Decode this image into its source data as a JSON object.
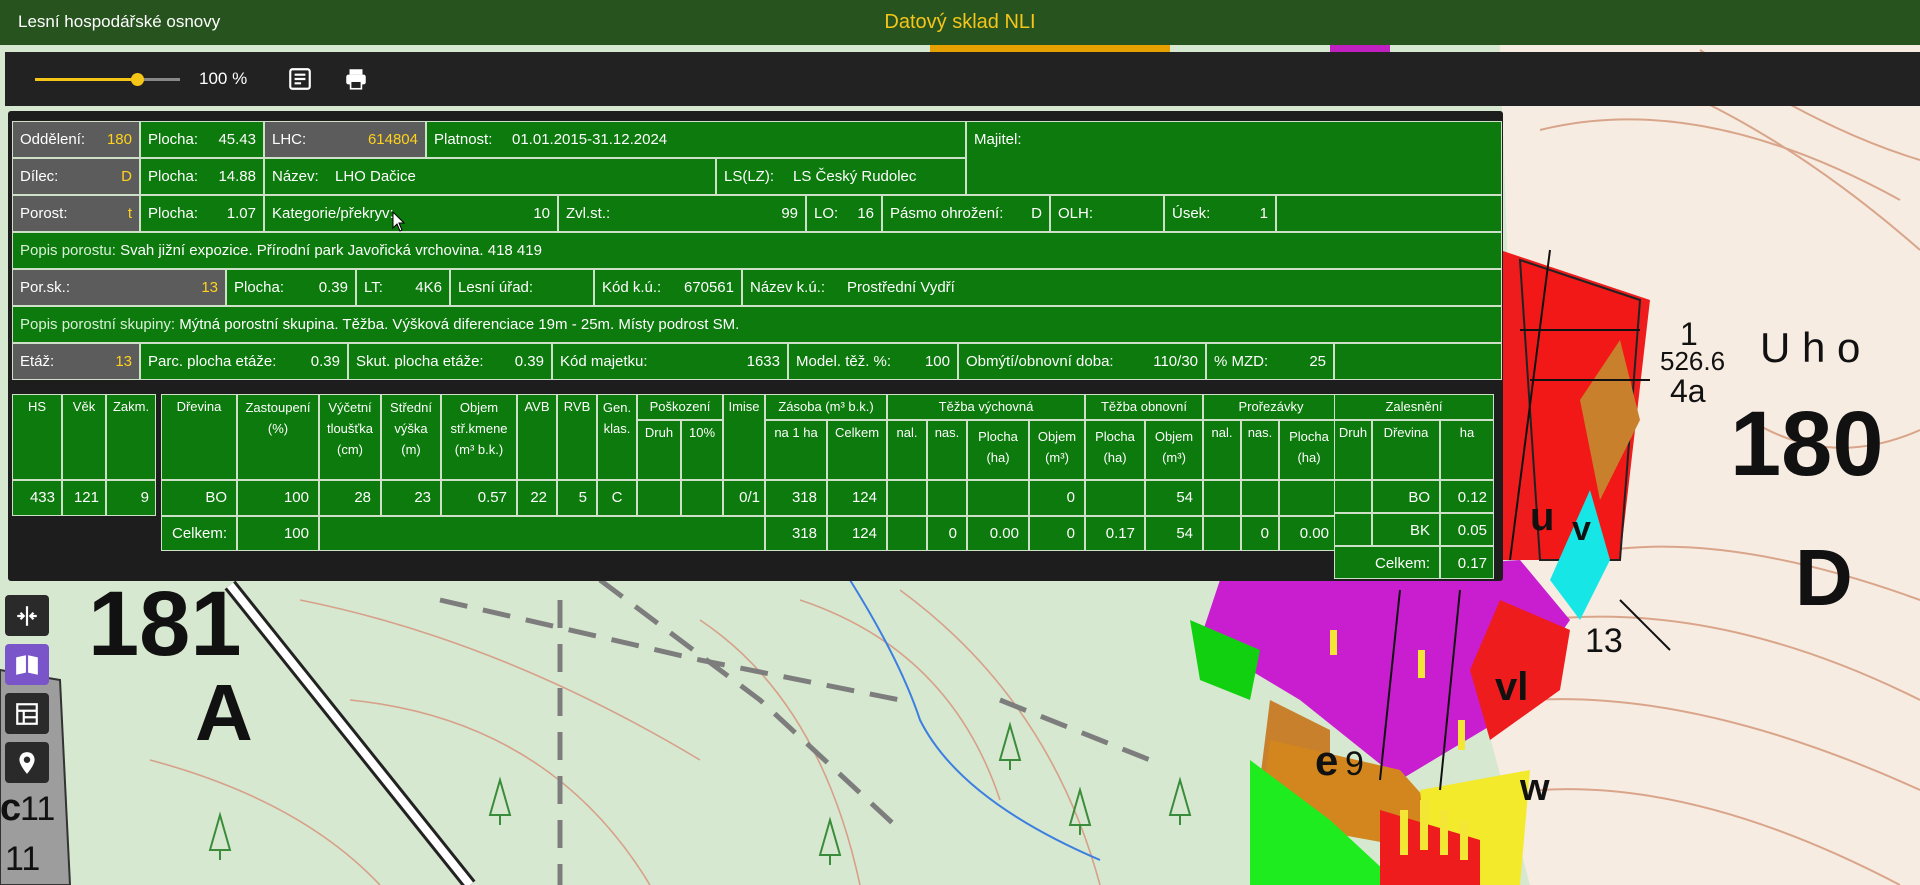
{
  "app": {
    "title": "Lesní hospodářské osnovy",
    "center_title": "Datový sklad NLI"
  },
  "toolbar": {
    "zoom_value": 0.7,
    "zoom_label": "100 %"
  },
  "header": {
    "oddeleni_label": "Oddělení:",
    "oddeleni_value": "180",
    "plocha1_label": "Plocha:",
    "plocha1_value": "45.43",
    "lhc_label": "LHC:",
    "lhc_value": "614804",
    "platnost_label": "Platnost:",
    "platnost_value": "01.01.2015-31.12.2024",
    "majitel_label": "Majitel:",
    "dilec_label": "Dílec:",
    "dilec_value": "D",
    "plocha2_label": "Plocha:",
    "plocha2_value": "14.88",
    "nazev_label": "Název:",
    "nazev_value": "LHO Dačice",
    "lslz_label": "LS(LZ):",
    "lslz_value": "LS Český Rudolec",
    "porost_label": "Porost:",
    "porost_value": "t",
    "plocha3_label": "Plocha:",
    "plocha3_value": "1.07",
    "kategorie_label": "Kategorie/překryv:",
    "kategorie_value": "10",
    "zvlst_label": "Zvl.st.:",
    "zvlst_value": "99",
    "lo_label": "LO:",
    "lo_value": "16",
    "pasmo_label": "Pásmo ohrožení:",
    "pasmo_value": "D",
    "olh_label": "OLH:",
    "usek_label": "Úsek:",
    "usek_value": "1",
    "popis_porostu_label": "Popis porostu:",
    "popis_porostu_value": "Svah jižní expozice. Přírodní park Javořická vrchovina. 418 419",
    "porsk_label": "Por.sk.:",
    "porsk_value": "13",
    "plocha4_label": "Plocha:",
    "plocha4_value": "0.39",
    "lt_label": "LT:",
    "lt_value": "4K6",
    "lesni_urad_label": "Lesní úřad:",
    "kodku_label": "Kód k.ú.:",
    "kodku_value": "670561",
    "nazevku_label": "Název k.ú.:",
    "nazevku_value": "Prostřední Vydří",
    "popis_skupiny_label": "Popis porostní skupiny:",
    "popis_skupiny_value": "Mýtná porostní skupina. Těžba. Výšková diferenciace 19m - 25m. Místy podrost SM.",
    "etaz_label": "Etáž:",
    "etaz_value": "13",
    "parc_label": "Parc. plocha etáže:",
    "parc_value": "0.39",
    "skut_label": "Skut. plocha etáže:",
    "skut_value": "0.39",
    "kodmaj_label": "Kód majetku:",
    "kodmaj_value": "1633",
    "model_label": "Model. těž. %:",
    "model_value": "100",
    "obmyti_label": "Obmýtí/obnovní doba:",
    "obmyti_value": "110/30",
    "mzd_label": "% MZD:",
    "mzd_value": "25"
  },
  "left_table": {
    "headers": [
      "HS",
      "Věk",
      "Zakm."
    ],
    "values": [
      "433",
      "121",
      "9"
    ]
  },
  "main_table": {
    "h_drevina": "Dřevina",
    "h_zastoupeni": [
      "Zastoupení",
      "(%)"
    ],
    "h_vycetni": [
      "Výčetní",
      "tloušťka",
      "(cm)"
    ],
    "h_stredni": [
      "Střední",
      "výška",
      "(m)"
    ],
    "h_objem": [
      "Objem",
      "stř.kmene",
      "(m³ b.k.)"
    ],
    "h_avb": "AVB",
    "h_rvb": "RVB",
    "h_gen": [
      "Gen.",
      "klas."
    ],
    "h_poskozeni": "Poškození",
    "h_druh": "Druh",
    "h_10": "10%",
    "h_imise": "Imise",
    "h_zasoba": "Zásoba (m³ b.k.)",
    "h_na1ha": "na 1 ha",
    "h_celkem": "Celkem",
    "h_tv": "Těžba výchovná",
    "h_nal": "nal.",
    "h_nas": "nas.",
    "h_plocha": [
      "Plocha",
      "(ha)"
    ],
    "h_objem2": [
      "Objem",
      "(m³)"
    ],
    "h_to": "Těžba obnovní",
    "h_prorezavky": "Prořezávky",
    "row": {
      "drevina": "BO",
      "zastoupeni": "100",
      "vycetni": "28",
      "stredni": "23",
      "objem": "0.57",
      "avb": "22",
      "rvb": "5",
      "gen": "C",
      "imise": "0/1",
      "na1ha": "318",
      "celkem": "124",
      "tv_objem": "0",
      "to_objem": "54"
    },
    "total": {
      "label": "Celkem:",
      "zastoupeni": "100",
      "na1ha": "318",
      "celkem": "124",
      "tv_nas": "0",
      "tv_plocha": "0.00",
      "tv_objem": "0",
      "to_plocha": "0.17",
      "to_objem": "54",
      "pr_nas": "0",
      "pr_plocha": "0.00"
    }
  },
  "zalesneni": {
    "title": "Zalesnění",
    "h_druh": "Druh",
    "h_drevina": "Dřevina",
    "h_ha": "ha",
    "rows": [
      {
        "drevina": "BO",
        "ha": "0.12"
      },
      {
        "drevina": "BK",
        "ha": "0.05"
      }
    ],
    "total_label": "Celkem:",
    "total_value": "0.17"
  },
  "map_labels": {
    "l180": "180",
    "lD": "D",
    "l181": "181",
    "lA": "A",
    "elev": "526.6",
    "uho": "U  h o",
    "l4a": "4a",
    "l1": "1",
    "l13": "13",
    "le": "e",
    "l9": "9",
    "lw": "w",
    "lu": "u",
    "lv": "v",
    "lvl": "vl",
    "lc": "c",
    "l11": "11",
    "l11b": "11"
  },
  "colors": {
    "topbar": "#27531f",
    "cell_green": "#0c7a0c",
    "key_gray": "#5c5c5c",
    "accent_yellow": "#ffd21c",
    "sidebar_active": "#7a55c9"
  },
  "sidebar": {
    "icons": [
      "split-icon",
      "map-book-icon",
      "layers-table-icon",
      "location-pin-icon"
    ]
  }
}
